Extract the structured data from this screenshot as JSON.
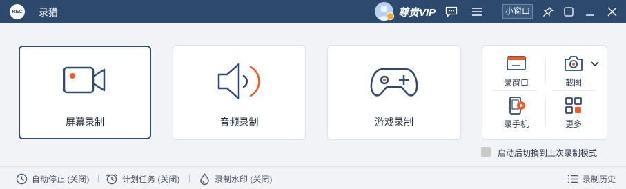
{
  "app": {
    "title": "录猎",
    "logo_text": "REC"
  },
  "titlebar": {
    "vip_label": "尊贵VIP",
    "mini_window_label": "小窗口"
  },
  "cards": [
    {
      "label": "屏幕录制"
    },
    {
      "label": "音频录制"
    },
    {
      "label": "游戏录制"
    }
  ],
  "more_tools": [
    {
      "label": "录窗口"
    },
    {
      "label": "截图"
    },
    {
      "label": "录手机"
    },
    {
      "label": "更多"
    }
  ],
  "startup_option": {
    "label": "启动后切换到上次录制模式",
    "checked": false
  },
  "bottom": {
    "auto_stop": "自动停止 (关闭)",
    "schedule": "计划任务 (关闭)",
    "watermark": "录制水印 (关闭)",
    "history": "录制历史"
  },
  "colors": {
    "titlebar": "#2d4a6e",
    "accent": "#f05a28",
    "icon_stroke": "#2d4a6e"
  }
}
